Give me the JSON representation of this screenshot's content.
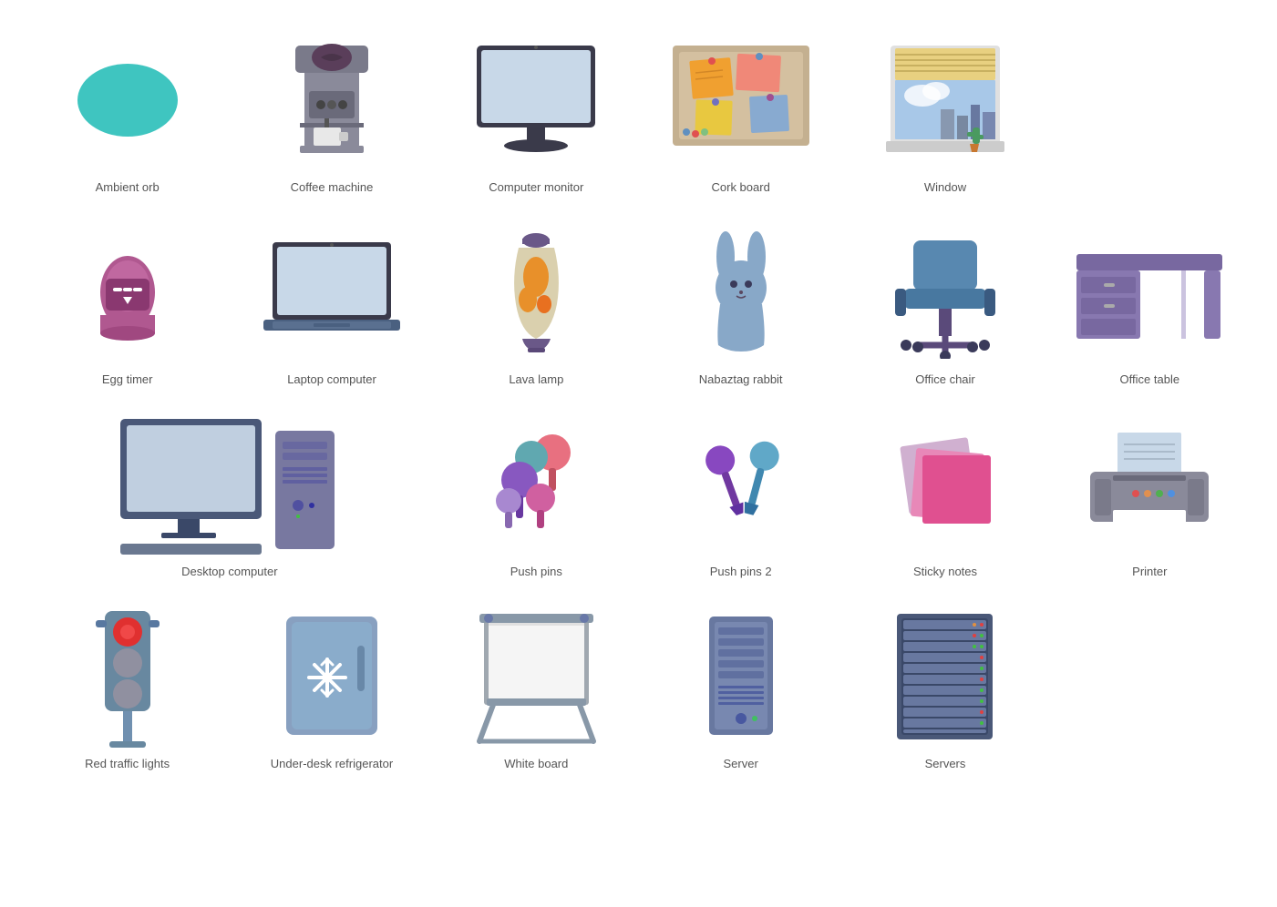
{
  "items": [
    {
      "id": "ambient-orb",
      "label": "Ambient orb"
    },
    {
      "id": "coffee-machine",
      "label": "Coffee machine"
    },
    {
      "id": "computer-monitor",
      "label": "Computer monitor"
    },
    {
      "id": "cork-board",
      "label": "Cork board"
    },
    {
      "id": "window",
      "label": "Window"
    },
    {
      "id": "egg-timer",
      "label": "Egg timer"
    },
    {
      "id": "laptop-computer",
      "label": "Laptop computer"
    },
    {
      "id": "lava-lamp",
      "label": "Lava lamp"
    },
    {
      "id": "nabaztag-rabbit",
      "label": "Nabaztag rabbit"
    },
    {
      "id": "office-chair",
      "label": "Office chair"
    },
    {
      "id": "office-table",
      "label": "Office table"
    },
    {
      "id": "desktop-computer",
      "label": "Desktop computer"
    },
    {
      "id": "push-pins",
      "label": "Push pins"
    },
    {
      "id": "push-pins-2",
      "label": "Push pins 2"
    },
    {
      "id": "sticky-notes",
      "label": "Sticky notes"
    },
    {
      "id": "printer",
      "label": "Printer"
    },
    {
      "id": "red-traffic-lights",
      "label": "Red traffic lights"
    },
    {
      "id": "refrigerator",
      "label": "Under-desk refrigerator"
    },
    {
      "id": "white-board",
      "label": "White board"
    },
    {
      "id": "server",
      "label": "Server"
    },
    {
      "id": "servers",
      "label": "Servers"
    }
  ]
}
